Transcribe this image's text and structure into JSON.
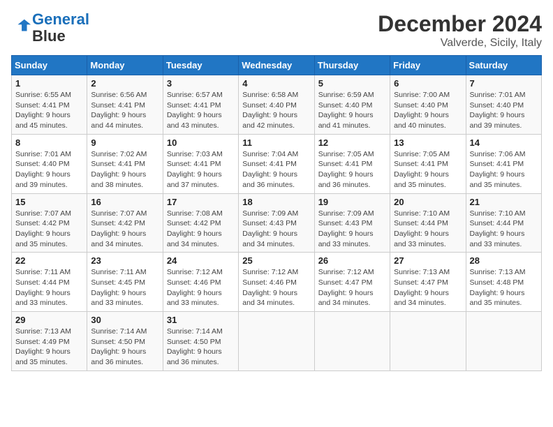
{
  "header": {
    "logo_line1": "General",
    "logo_line2": "Blue",
    "month": "December 2024",
    "location": "Valverde, Sicily, Italy"
  },
  "weekdays": [
    "Sunday",
    "Monday",
    "Tuesday",
    "Wednesday",
    "Thursday",
    "Friday",
    "Saturday"
  ],
  "weeks": [
    [
      {
        "day": "1",
        "sunrise": "Sunrise: 6:55 AM",
        "sunset": "Sunset: 4:41 PM",
        "daylight": "Daylight: 9 hours and 45 minutes."
      },
      {
        "day": "2",
        "sunrise": "Sunrise: 6:56 AM",
        "sunset": "Sunset: 4:41 PM",
        "daylight": "Daylight: 9 hours and 44 minutes."
      },
      {
        "day": "3",
        "sunrise": "Sunrise: 6:57 AM",
        "sunset": "Sunset: 4:41 PM",
        "daylight": "Daylight: 9 hours and 43 minutes."
      },
      {
        "day": "4",
        "sunrise": "Sunrise: 6:58 AM",
        "sunset": "Sunset: 4:40 PM",
        "daylight": "Daylight: 9 hours and 42 minutes."
      },
      {
        "day": "5",
        "sunrise": "Sunrise: 6:59 AM",
        "sunset": "Sunset: 4:40 PM",
        "daylight": "Daylight: 9 hours and 41 minutes."
      },
      {
        "day": "6",
        "sunrise": "Sunrise: 7:00 AM",
        "sunset": "Sunset: 4:40 PM",
        "daylight": "Daylight: 9 hours and 40 minutes."
      },
      {
        "day": "7",
        "sunrise": "Sunrise: 7:01 AM",
        "sunset": "Sunset: 4:40 PM",
        "daylight": "Daylight: 9 hours and 39 minutes."
      }
    ],
    [
      {
        "day": "8",
        "sunrise": "Sunrise: 7:01 AM",
        "sunset": "Sunset: 4:40 PM",
        "daylight": "Daylight: 9 hours and 39 minutes."
      },
      {
        "day": "9",
        "sunrise": "Sunrise: 7:02 AM",
        "sunset": "Sunset: 4:41 PM",
        "daylight": "Daylight: 9 hours and 38 minutes."
      },
      {
        "day": "10",
        "sunrise": "Sunrise: 7:03 AM",
        "sunset": "Sunset: 4:41 PM",
        "daylight": "Daylight: 9 hours and 37 minutes."
      },
      {
        "day": "11",
        "sunrise": "Sunrise: 7:04 AM",
        "sunset": "Sunset: 4:41 PM",
        "daylight": "Daylight: 9 hours and 36 minutes."
      },
      {
        "day": "12",
        "sunrise": "Sunrise: 7:05 AM",
        "sunset": "Sunset: 4:41 PM",
        "daylight": "Daylight: 9 hours and 36 minutes."
      },
      {
        "day": "13",
        "sunrise": "Sunrise: 7:05 AM",
        "sunset": "Sunset: 4:41 PM",
        "daylight": "Daylight: 9 hours and 35 minutes."
      },
      {
        "day": "14",
        "sunrise": "Sunrise: 7:06 AM",
        "sunset": "Sunset: 4:41 PM",
        "daylight": "Daylight: 9 hours and 35 minutes."
      }
    ],
    [
      {
        "day": "15",
        "sunrise": "Sunrise: 7:07 AM",
        "sunset": "Sunset: 4:42 PM",
        "daylight": "Daylight: 9 hours and 35 minutes."
      },
      {
        "day": "16",
        "sunrise": "Sunrise: 7:07 AM",
        "sunset": "Sunset: 4:42 PM",
        "daylight": "Daylight: 9 hours and 34 minutes."
      },
      {
        "day": "17",
        "sunrise": "Sunrise: 7:08 AM",
        "sunset": "Sunset: 4:42 PM",
        "daylight": "Daylight: 9 hours and 34 minutes."
      },
      {
        "day": "18",
        "sunrise": "Sunrise: 7:09 AM",
        "sunset": "Sunset: 4:43 PM",
        "daylight": "Daylight: 9 hours and 34 minutes."
      },
      {
        "day": "19",
        "sunrise": "Sunrise: 7:09 AM",
        "sunset": "Sunset: 4:43 PM",
        "daylight": "Daylight: 9 hours and 33 minutes."
      },
      {
        "day": "20",
        "sunrise": "Sunrise: 7:10 AM",
        "sunset": "Sunset: 4:44 PM",
        "daylight": "Daylight: 9 hours and 33 minutes."
      },
      {
        "day": "21",
        "sunrise": "Sunrise: 7:10 AM",
        "sunset": "Sunset: 4:44 PM",
        "daylight": "Daylight: 9 hours and 33 minutes."
      }
    ],
    [
      {
        "day": "22",
        "sunrise": "Sunrise: 7:11 AM",
        "sunset": "Sunset: 4:44 PM",
        "daylight": "Daylight: 9 hours and 33 minutes."
      },
      {
        "day": "23",
        "sunrise": "Sunrise: 7:11 AM",
        "sunset": "Sunset: 4:45 PM",
        "daylight": "Daylight: 9 hours and 33 minutes."
      },
      {
        "day": "24",
        "sunrise": "Sunrise: 7:12 AM",
        "sunset": "Sunset: 4:46 PM",
        "daylight": "Daylight: 9 hours and 33 minutes."
      },
      {
        "day": "25",
        "sunrise": "Sunrise: 7:12 AM",
        "sunset": "Sunset: 4:46 PM",
        "daylight": "Daylight: 9 hours and 34 minutes."
      },
      {
        "day": "26",
        "sunrise": "Sunrise: 7:12 AM",
        "sunset": "Sunset: 4:47 PM",
        "daylight": "Daylight: 9 hours and 34 minutes."
      },
      {
        "day": "27",
        "sunrise": "Sunrise: 7:13 AM",
        "sunset": "Sunset: 4:47 PM",
        "daylight": "Daylight: 9 hours and 34 minutes."
      },
      {
        "day": "28",
        "sunrise": "Sunrise: 7:13 AM",
        "sunset": "Sunset: 4:48 PM",
        "daylight": "Daylight: 9 hours and 35 minutes."
      }
    ],
    [
      {
        "day": "29",
        "sunrise": "Sunrise: 7:13 AM",
        "sunset": "Sunset: 4:49 PM",
        "daylight": "Daylight: 9 hours and 35 minutes."
      },
      {
        "day": "30",
        "sunrise": "Sunrise: 7:14 AM",
        "sunset": "Sunset: 4:50 PM",
        "daylight": "Daylight: 9 hours and 36 minutes."
      },
      {
        "day": "31",
        "sunrise": "Sunrise: 7:14 AM",
        "sunset": "Sunset: 4:50 PM",
        "daylight": "Daylight: 9 hours and 36 minutes."
      },
      null,
      null,
      null,
      null
    ]
  ]
}
